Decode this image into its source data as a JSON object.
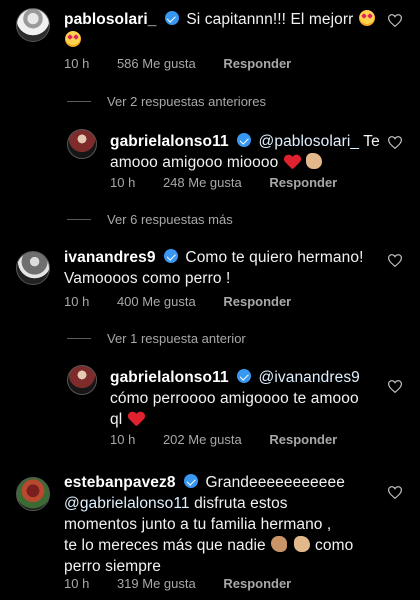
{
  "comments": [
    {
      "username": "pablosolari_",
      "verified": false,
      "text": "Si capitannn!!! El mejorr",
      "emoji": [
        "smiling-face-with-heart-eyes",
        "smiling-face-with-heart-eyes"
      ],
      "time": "10 h",
      "likes": "586 Me gusta",
      "reply": "Responder"
    },
    {
      "view_more": "Ver 2 respuestas anteriores"
    },
    {
      "username": "gabrielalonso11",
      "verified": true,
      "mention": "@pablosolari_",
      "text_line1": "Te",
      "text_line2": "amooo amigooo mioooo",
      "emoji": [
        "red-heart",
        "clapping-hands"
      ],
      "time": "10 h",
      "likes": "248 Me gusta",
      "reply": "Responder"
    },
    {
      "view_more": "Ver 6 respuestas más"
    },
    {
      "username": "ivanandres9",
      "verified": true,
      "text_line1": "Como te quiero hermano!",
      "text_line2": "Vamoooos como perro !",
      "time": "10 h",
      "likes": "400 Me gusta",
      "reply": "Responder"
    },
    {
      "view_more": "Ver 1 respuesta anterior"
    },
    {
      "username": "gabrielalonso11",
      "verified": true,
      "mention": "@ivanandres9",
      "text_line2": "cómo perroooo amigoooo te amooo",
      "text_line3": "ql",
      "emoji": [
        "red-heart"
      ],
      "time": "10 h",
      "likes": "202 Me gusta",
      "reply": "Responder"
    },
    {
      "username": "estebanpavez8",
      "verified": true,
      "text_line1": "Grandeeeeeeeeeee",
      "mention": "@gabrielalonso11",
      "text_line2": "disfruta estos",
      "text_line3": "momentos junto a tu familia hermano ,",
      "text_line4": "te lo mereces más que nadie",
      "text_line4b": "como",
      "text_line5": "perro siempre",
      "emoji": [
        "ok-hand",
        "clapping-hands"
      ],
      "time": "10 h",
      "likes": "319 Me gusta",
      "reply": "Responder"
    }
  ],
  "colors": {
    "background": "#000000",
    "text": "#f2f2f2",
    "meta": "#a8a8a8",
    "verified": "#3897f0",
    "heart": "#e0212e"
  }
}
